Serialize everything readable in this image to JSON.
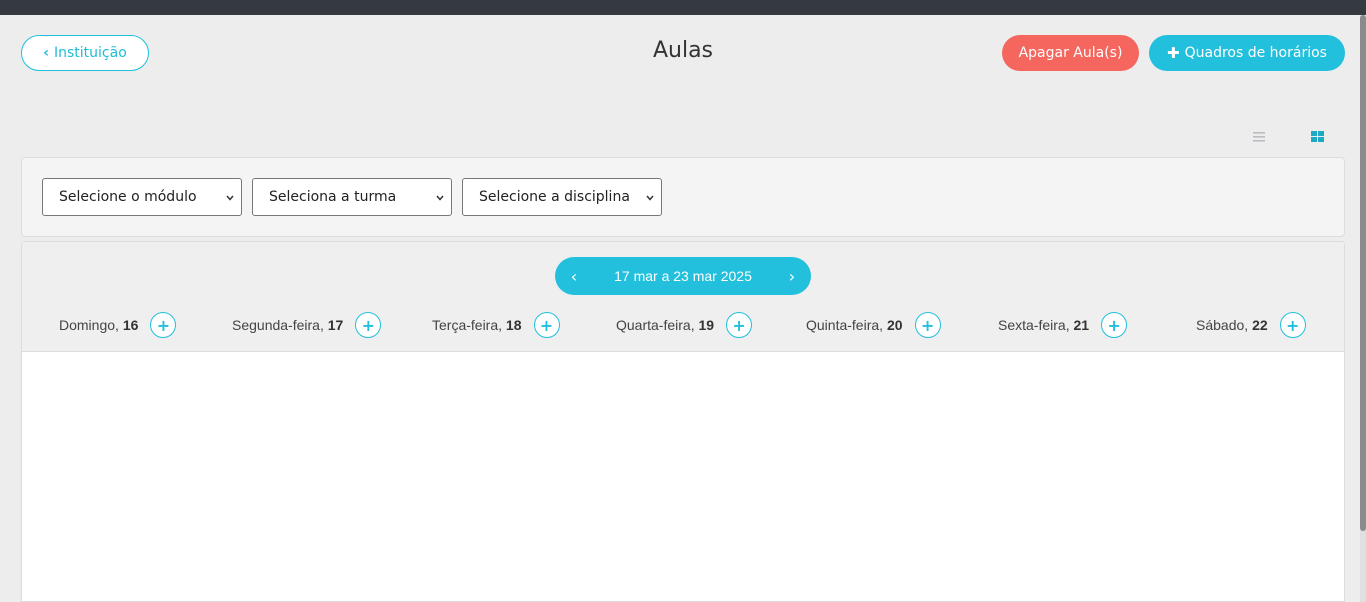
{
  "header": {
    "back_label": "Instituição",
    "title": "Aulas",
    "delete_label": "Apagar Aula(s)",
    "schedules_label": "Quadros de horários"
  },
  "view_toggle": {
    "list_icon": "list-icon",
    "grid_icon": "grid-icon"
  },
  "filters": {
    "module": "Selecione o módulo",
    "class": "Seleciona a turma",
    "subject": "Selecione a disciplina"
  },
  "calendar": {
    "week_range": "17 mar a 23 mar 2025",
    "days": [
      {
        "name": "Domingo,",
        "num": "16"
      },
      {
        "name": "Segunda-feira,",
        "num": "17"
      },
      {
        "name": "Terça-feira,",
        "num": "18"
      },
      {
        "name": "Quarta-feira,",
        "num": "19"
      },
      {
        "name": "Quinta-feira,",
        "num": "20"
      },
      {
        "name": "Sexta-feira,",
        "num": "21"
      },
      {
        "name": "Sábado,",
        "num": "22"
      }
    ]
  },
  "colors": {
    "accent": "#22c0dc",
    "danger": "#f4665e",
    "topbar": "#343a40"
  }
}
